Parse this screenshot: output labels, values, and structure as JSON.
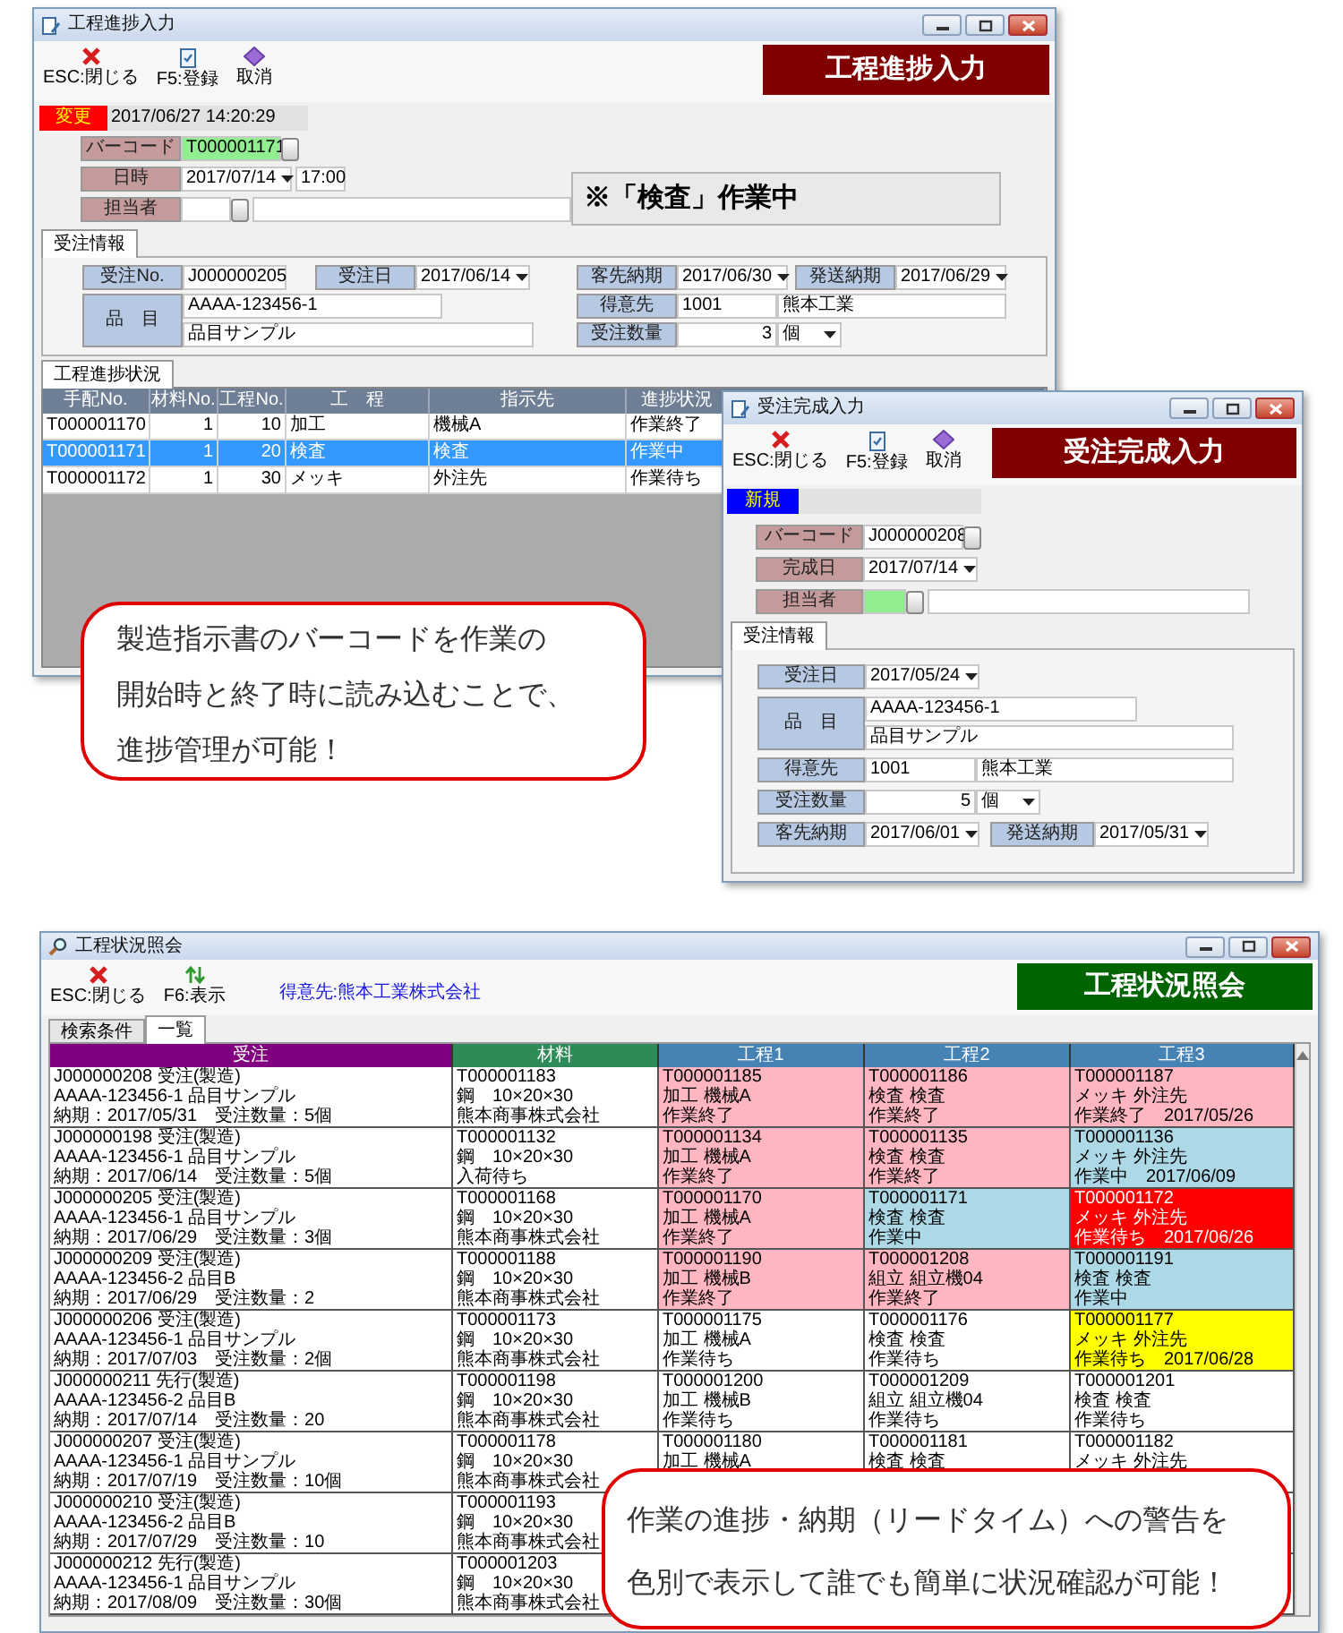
{
  "progress_window": {
    "title": "工程進捗入力",
    "toolbar": [
      {
        "label": "ESC:閉じる"
      },
      {
        "label": "F5:登録"
      },
      {
        "label": "取消"
      }
    ],
    "banner": "工程進捗入力",
    "mode": "変更",
    "timestamp": "2017/06/27 14:20:29",
    "barcode": {
      "label": "バーコード",
      "value": "T000001171"
    },
    "date": {
      "label": "日時",
      "value": "2017/07/14",
      "time": "17:00"
    },
    "person": {
      "label": "担当者"
    },
    "status_message": "※「検査」作業中",
    "tabs": [
      {
        "label": "受注情報",
        "selected": true
      }
    ],
    "order_no": {
      "label": "受注No.",
      "value": "J000000205"
    },
    "order_date": {
      "label": "受注日",
      "value": "2017/06/14"
    },
    "customer_due": {
      "label": "客先納期",
      "value": "2017/06/30"
    },
    "ship_due": {
      "label": "発送納期",
      "value": "2017/06/29"
    },
    "item": {
      "label": "品　目",
      "code": "AAAA-123456-1",
      "name": "品目サンプル"
    },
    "customer": {
      "label": "得意先",
      "code": "1001",
      "name": "熊本工業"
    },
    "quantity": {
      "label": "受注数量",
      "value": "3",
      "unit": "個"
    },
    "grid_tabs": [
      {
        "label": "工程進捗状況",
        "selected": true
      }
    ],
    "grid": {
      "columns": [
        "手配No.",
        "材料No.",
        "工程No.",
        "工　程",
        "指示先",
        "進捗状況"
      ],
      "rows": [
        {
          "cells": [
            "T000001170",
            "1",
            "10",
            "加工",
            "機械A",
            "作業終了"
          ],
          "selected": false
        },
        {
          "cells": [
            "T000001171",
            "1",
            "20",
            "検査",
            "検査",
            "作業中"
          ],
          "selected": true
        },
        {
          "cells": [
            "T000001172",
            "1",
            "30",
            "メッキ",
            "外注先",
            "作業待ち"
          ],
          "selected": false
        }
      ]
    }
  },
  "completion_window": {
    "title": "受注完成入力",
    "toolbar": [
      {
        "label": "ESC:閉じる"
      },
      {
        "label": "F5:登録"
      },
      {
        "label": "取消"
      }
    ],
    "banner": "受注完成入力",
    "mode": "新規",
    "barcode": {
      "label": "バーコード",
      "value": "J000000208"
    },
    "completion_date": {
      "label": "完成日",
      "value": "2017/07/14"
    },
    "person": {
      "label": "担当者"
    },
    "tabs": [
      {
        "label": "受注情報",
        "selected": true
      }
    ],
    "order_date": {
      "label": "受注日",
      "value": "2017/05/24"
    },
    "item": {
      "label": "品　目",
      "code": "AAAA-123456-1",
      "name": "品目サンプル"
    },
    "customer": {
      "label": "得意先",
      "code": "1001",
      "name": "熊本工業"
    },
    "quantity": {
      "label": "受注数量",
      "value": "5",
      "unit": "個"
    },
    "customer_due": {
      "label": "客先納期",
      "value": "2017/06/01"
    },
    "ship_due": {
      "label": "発送納期",
      "value": "2017/05/31"
    }
  },
  "status_window": {
    "title": "工程状況照会",
    "toolbar": [
      {
        "label": "ESC:閉じる"
      },
      {
        "label": "F6:表示"
      }
    ],
    "customer_filter": "得意先:熊本工業株式会社",
    "banner": "工程状況照会",
    "tabs": [
      {
        "label": "検索条件",
        "selected": false
      },
      {
        "label": "一覧",
        "selected": true
      }
    ],
    "columns": [
      {
        "label": "受注",
        "color": "#800080"
      },
      {
        "label": "材料",
        "color": "#2e8b57"
      },
      {
        "label": "工程1",
        "color": "#4682b4"
      },
      {
        "label": "工程2",
        "color": "#4682b4"
      },
      {
        "label": "工程3",
        "color": "#4682b4"
      }
    ],
    "rows": [
      {
        "order": [
          "J000000208 受注(製造)",
          "AAAA-123456-1 品目サンプル",
          "納期：2017/05/31　受注数量：5個"
        ],
        "material": [
          "T000001183",
          "鋼　10×20×30",
          "熊本商事株式会社"
        ],
        "steps": [
          {
            "lines": [
              "T000001185",
              "加工 機械A",
              "作業終了"
            ],
            "color": "#ffb6c1"
          },
          {
            "lines": [
              "T000001186",
              "検査 検査",
              "作業終了"
            ],
            "color": "#ffb6c1"
          },
          {
            "lines": [
              "T000001187",
              "メッキ 外注先",
              "作業終了　2017/05/26"
            ],
            "color": "#ffb6c1"
          }
        ]
      },
      {
        "order": [
          "J000000198 受注(製造)",
          "AAAA-123456-1 品目サンプル",
          "納期：2017/06/14　受注数量：5個"
        ],
        "material": [
          "T000001132",
          "鋼　10×20×30",
          "入荷待ち"
        ],
        "steps": [
          {
            "lines": [
              "T000001134",
              "加工 機械A",
              "作業終了"
            ],
            "color": "#ffb6c1"
          },
          {
            "lines": [
              "T000001135",
              "検査 検査",
              "作業終了"
            ],
            "color": "#ffb6c1"
          },
          {
            "lines": [
              "T000001136",
              "メッキ 外注先",
              "作業中　2017/06/09"
            ],
            "color": "#add8e6"
          }
        ]
      },
      {
        "order": [
          "J000000205 受注(製造)",
          "AAAA-123456-1 品目サンプル",
          "納期：2017/06/29　受注数量：3個"
        ],
        "material": [
          "T000001168",
          "鋼　10×20×30",
          "熊本商事株式会社"
        ],
        "steps": [
          {
            "lines": [
              "T000001170",
              "加工 機械A",
              "作業終了"
            ],
            "color": "#ffb6c1"
          },
          {
            "lines": [
              "T000001171",
              "検査 検査",
              "作業中"
            ],
            "color": "#add8e6"
          },
          {
            "lines": [
              "T000001172",
              "メッキ 外注先",
              "作業待ち　2017/06/26"
            ],
            "color": "#ff0000"
          }
        ]
      },
      {
        "order": [
          "J000000209 受注(製造)",
          "AAAA-123456-2 品目B",
          "納期：2017/06/29　受注数量：2"
        ],
        "material": [
          "T000001188",
          "鋼　10×20×30",
          "熊本商事株式会社"
        ],
        "steps": [
          {
            "lines": [
              "T000001190",
              "加工 機械B",
              "作業終了"
            ],
            "color": "#ffb6c1"
          },
          {
            "lines": [
              "T000001208",
              "組立 組立機04",
              "作業終了"
            ],
            "color": "#ffb6c1"
          },
          {
            "lines": [
              "T000001191",
              "検査 検査",
              "作業中"
            ],
            "color": "#add8e6"
          }
        ]
      },
      {
        "order": [
          "J000000206 受注(製造)",
          "AAAA-123456-1 品目サンプル",
          "納期：2017/07/03　受注数量：2個"
        ],
        "material": [
          "T000001173",
          "鋼　10×20×30",
          "熊本商事株式会社"
        ],
        "steps": [
          {
            "lines": [
              "T000001175",
              "加工 機械A",
              "作業待ち"
            ],
            "color": "#ffffff"
          },
          {
            "lines": [
              "T000001176",
              "検査 検査",
              "作業待ち"
            ],
            "color": "#ffffff"
          },
          {
            "lines": [
              "T000001177",
              "メッキ 外注先",
              "作業待ち　2017/06/28"
            ],
            "color": "#ffff00"
          }
        ]
      },
      {
        "order": [
          "J000000211 先行(製造)",
          "AAAA-123456-2 品目B",
          "納期：2017/07/14　受注数量：20"
        ],
        "material": [
          "T000001198",
          "鋼　10×20×30",
          "熊本商事株式会社"
        ],
        "steps": [
          {
            "lines": [
              "T000001200",
              "加工 機械B",
              "作業待ち"
            ],
            "color": "#ffffff"
          },
          {
            "lines": [
              "T000001209",
              "組立 組立機04",
              "作業待ち"
            ],
            "color": "#ffffff"
          },
          {
            "lines": [
              "T000001201",
              "検査 検査",
              "作業待ち"
            ],
            "color": "#ffffff"
          }
        ]
      },
      {
        "order": [
          "J000000207 受注(製造)",
          "AAAA-123456-1 品目サンプル",
          "納期：2017/07/19　受注数量：10個"
        ],
        "material": [
          "T000001178",
          "鋼　10×20×30",
          "熊本商事株式会社"
        ],
        "steps": [
          {
            "lines": [
              "T000001180",
              "加工 機械A"
            ],
            "color": "#ffffff"
          },
          {
            "lines": [
              "T000001181",
              "検査 検査"
            ],
            "color": "#ffffff"
          },
          {
            "lines": [
              "T000001182",
              "メッキ 外注先"
            ],
            "color": "#ffffff"
          }
        ]
      },
      {
        "order": [
          "J000000210 受注(製造)",
          "AAAA-123456-2 品目B",
          "納期：2017/07/29　受注数量：10"
        ],
        "material": [
          "T000001193",
          "鋼　10×20×30",
          "熊本商事株式会社"
        ]
      },
      {
        "order": [
          "J000000212 先行(製造)",
          "AAAA-123456-1 品目サンプル",
          "納期：2017/08/09　受注数量：30個"
        ],
        "material": [
          "T000001203",
          "鋼　10×20×30",
          "熊本商事株式会社"
        ]
      }
    ]
  },
  "callouts": [
    {
      "lines": [
        "製造指示書のバーコードを作業の",
        "開始時と終了時に読み込むことで、",
        "進捗管理が可能！"
      ]
    },
    {
      "lines": [
        "作業の進捗・納期（リードタイム）への警告を",
        "色別で表示して誰でも簡単に状況確認が可能！"
      ]
    }
  ]
}
